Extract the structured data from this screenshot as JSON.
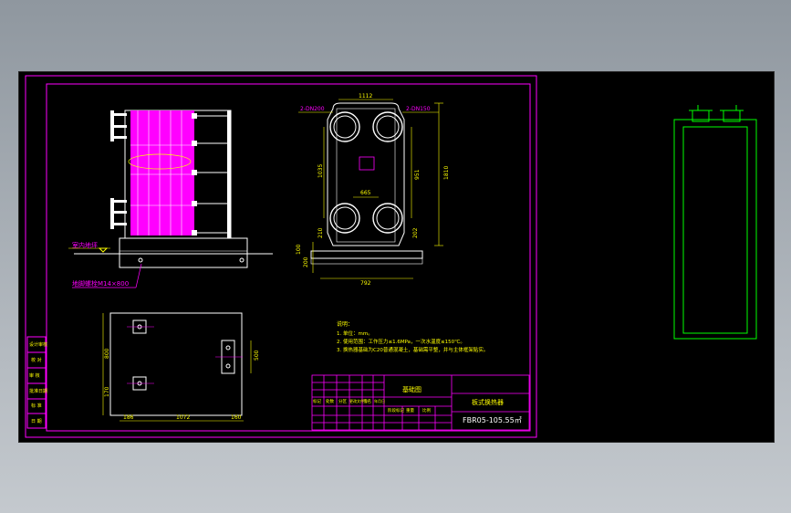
{
  "viewport": {
    "background": "#000000"
  },
  "colors": {
    "frame": "#ff00ff",
    "plates": "#ff00ff",
    "outline": "#ffffff",
    "dimension": "#ffff00",
    "green_view": "#00ff00",
    "text_yellow": "#ffff00"
  },
  "front_view": {
    "floor_label": "室内地坪",
    "anchor_label": "地脚螺栓M14×800"
  },
  "side_view": {
    "nozzle_left": "2-DN200",
    "nozzle_right": "2-DN150",
    "dim_top_width": "1112",
    "dim_height_total": "1810",
    "dim_port_spacing": "1035",
    "dim_inner": "951",
    "dim_center": "665",
    "dim_bottom": "202",
    "dim_base": "100",
    "dim_left_low": "210",
    "dim_foot": "200",
    "dim_base_width": "792"
  },
  "plan_view": {
    "dim_left": "800",
    "dim_left_small": "170",
    "dim_bottom_left": "186",
    "dim_bottom_mid": "1072",
    "dim_bottom_right": "160",
    "dim_right": "500"
  },
  "notes": {
    "title": "说明：",
    "lines": [
      "1. 单位：mm。",
      "2. 使用范围：工作压力≤1.6MPa，一次水温度≤150℃。",
      "3. 换热器基础为C20普通混凝土，基础需平整，并与主体框架贴实。"
    ]
  },
  "title_block": {
    "drawing_name": "板式换热器",
    "view_name": "基础图",
    "model": "FBR05-105.55㎡",
    "rows_left": [
      "标记",
      "处数",
      "分区",
      "更改文件号",
      "签名",
      "年月日"
    ],
    "rows_mid": [
      "阶段标记",
      "重量",
      "比例"
    ],
    "side_labels": [
      "设计审核",
      "校 对",
      "审 核",
      "批准日期",
      "标 准",
      "日 期"
    ]
  }
}
